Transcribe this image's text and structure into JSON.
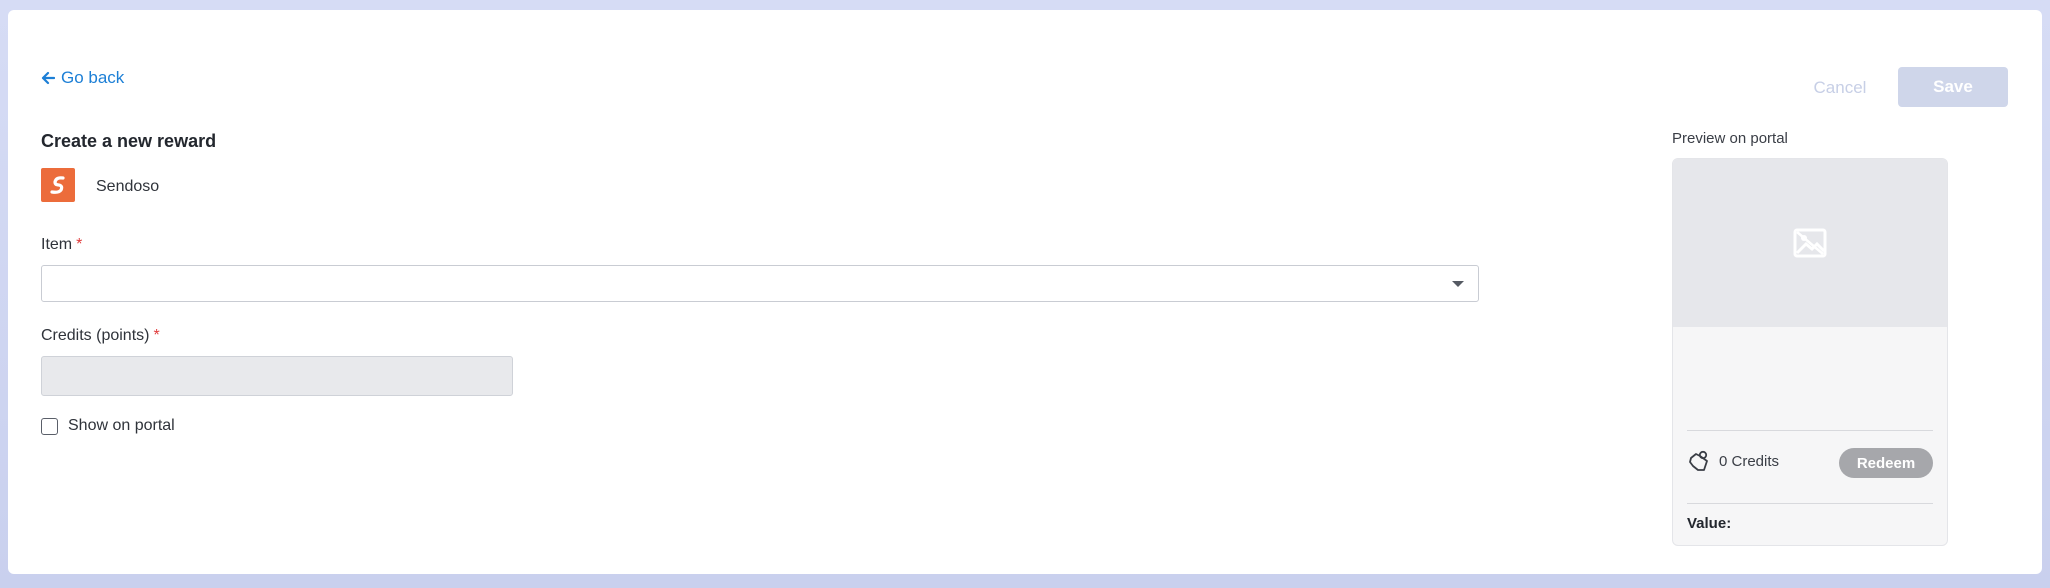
{
  "nav": {
    "go_back": "Go back"
  },
  "actions": {
    "cancel": "Cancel",
    "save": "Save"
  },
  "form": {
    "title": "Create a new reward",
    "vendor": {
      "name": "Sendoso",
      "logo_letter": "S",
      "logo_color": "#ec6c3b"
    },
    "item": {
      "label": "Item",
      "required_mark": "*",
      "value": ""
    },
    "credits": {
      "label": "Credits (points)",
      "required_mark": "*",
      "value": ""
    },
    "show_on_portal": {
      "label": "Show on portal",
      "checked": false
    }
  },
  "preview": {
    "label": "Preview on portal",
    "image_icon": "image-placeholder-icon",
    "credits_icon": "piggy-bank-icon",
    "credits_text": "0 Credits",
    "redeem": "Redeem",
    "value_label": "Value:"
  },
  "colors": {
    "link": "#1c7fd6",
    "required": "#e03b3b",
    "save_disabled": "#cfd6ea",
    "redeem_disabled": "#a6a7ab"
  }
}
